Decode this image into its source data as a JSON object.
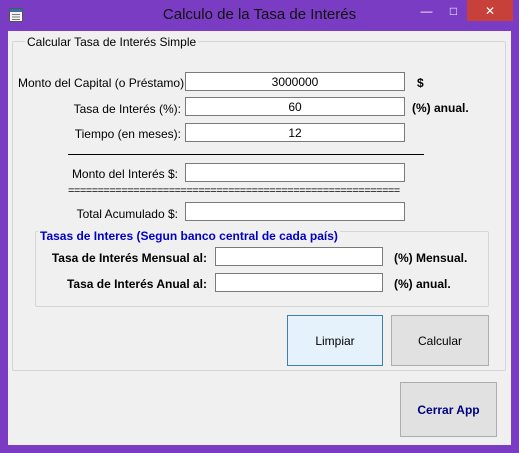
{
  "window": {
    "title": "Calculo de la Tasa de Interés",
    "controls": {
      "minimize": "—",
      "maximize": "□",
      "close": "✕"
    }
  },
  "group": {
    "legend": "Calcular Tasa de Interés Simple",
    "capital": {
      "label": "Monto del Capital (o Préstamo):",
      "value": "3000000",
      "unit": "$"
    },
    "rate": {
      "label": "Tasa de Interés (%):",
      "value": "60",
      "unit": "(%) anual."
    },
    "time": {
      "label": "Tiempo (en meses):",
      "value": "12"
    },
    "interest": {
      "label": "Monto del Interés $:",
      "value": ""
    },
    "separator": "========================================================",
    "total": {
      "label": "Total Acumulado $:",
      "value": ""
    },
    "rates_group": {
      "legend": "Tasas de Interes (Segun banco central de cada país)",
      "monthly": {
        "label": "Tasa de Interés Mensual al:",
        "value": "",
        "unit": "(%) Mensual."
      },
      "annual": {
        "label": "Tasa de Interés Anual al:",
        "value": "",
        "unit": "(%) anual."
      }
    },
    "buttons": {
      "clear": "Limpiar",
      "calculate": "Calcular"
    }
  },
  "exit_button": "Cerrar App"
}
